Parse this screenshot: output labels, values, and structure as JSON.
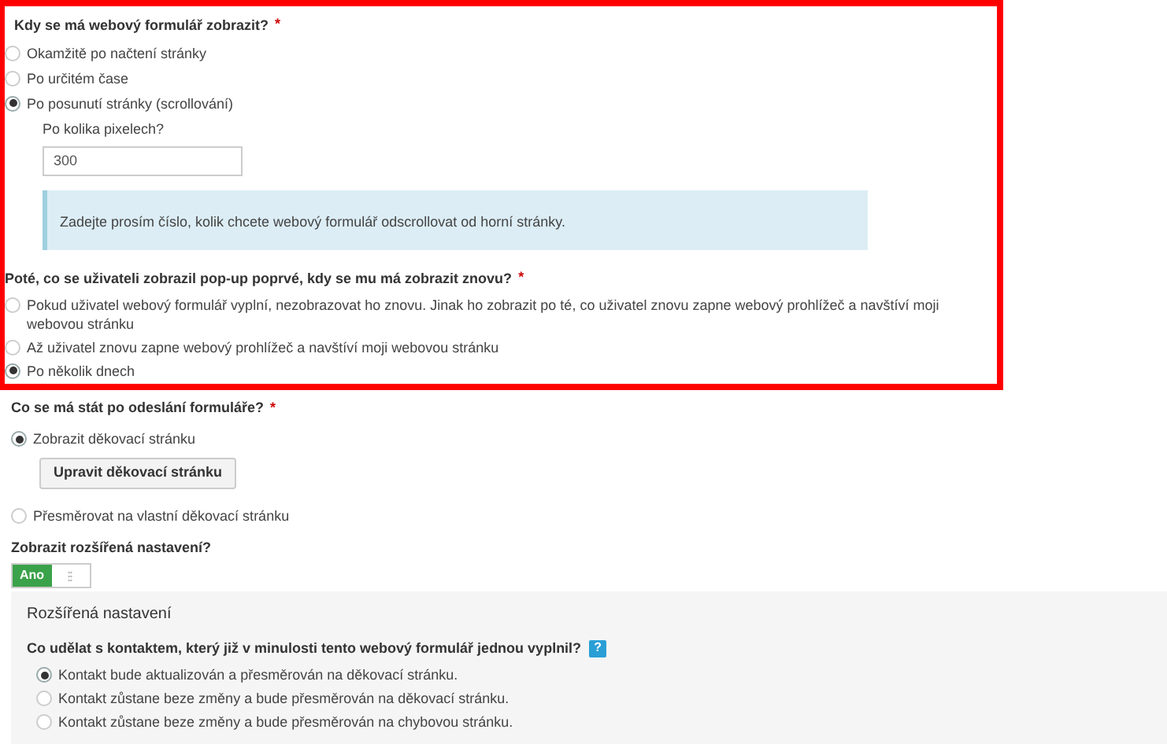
{
  "display_section": {
    "highlighted": true,
    "question_when": {
      "label": "Kdy se má webový formulář zobrazit?",
      "required_mark": "*",
      "options": [
        {
          "label": "Okamžitě po načtení stránky",
          "selected": false
        },
        {
          "label": "Po určitém čase",
          "selected": false
        },
        {
          "label": "Po posunutí stránky (scrollování)",
          "selected": true
        }
      ]
    },
    "pixels_field": {
      "label": "Po kolika pixelech?",
      "value": "300"
    },
    "info_box": {
      "text": "Zadejte prosím číslo, kolik chcete webový formulář odscrollovat od horní stránky."
    },
    "question_again": {
      "label": "Poté, co se uživateli zobrazil pop-up poprvé, kdy se mu má zobrazit znovu?",
      "required_mark": "*",
      "options": [
        {
          "label": "Pokud uživatel webový formulář vyplní, nezobrazovat ho znovu. Jinak ho zobrazit po té, co uživatel znovu zapne webový prohlížeč a navštíví moji webovou stránku",
          "selected": false
        },
        {
          "label": "Až uživatel znovu zapne webový prohlížeč a navštíví moji webovou stránku",
          "selected": false
        },
        {
          "label": "Po několik dnech",
          "selected": true
        }
      ]
    }
  },
  "question_after_submit": {
    "label": "Co se má stát po odeslání formuláře?",
    "required_mark": "*",
    "options": [
      {
        "label": "Zobrazit děkovací stránku",
        "selected": true,
        "button": "Upravit děkovací stránku"
      },
      {
        "label": "Přesměrovat na vlastní děkovací stránku",
        "selected": false
      }
    ]
  },
  "advanced_toggle": {
    "label": "Zobrazit rozšířená nastavení?",
    "on": true,
    "on_text": "Ano"
  },
  "advanced_panel": {
    "title": "Rozšířená nastavení",
    "question": {
      "label": "Co udělat s kontaktem, který již v minulosti tento webový formulář jednou vyplnil?",
      "help": "?",
      "options": [
        {
          "label": "Kontakt bude aktualizován a přesměrován na děkovací stránku.",
          "selected": true
        },
        {
          "label": "Kontakt zůstane beze změny a bude přesměrován na děkovací stránku.",
          "selected": false
        },
        {
          "label": "Kontakt zůstane beze změny a bude přesměrován na chybovou stránku.",
          "selected": false
        }
      ]
    }
  }
}
